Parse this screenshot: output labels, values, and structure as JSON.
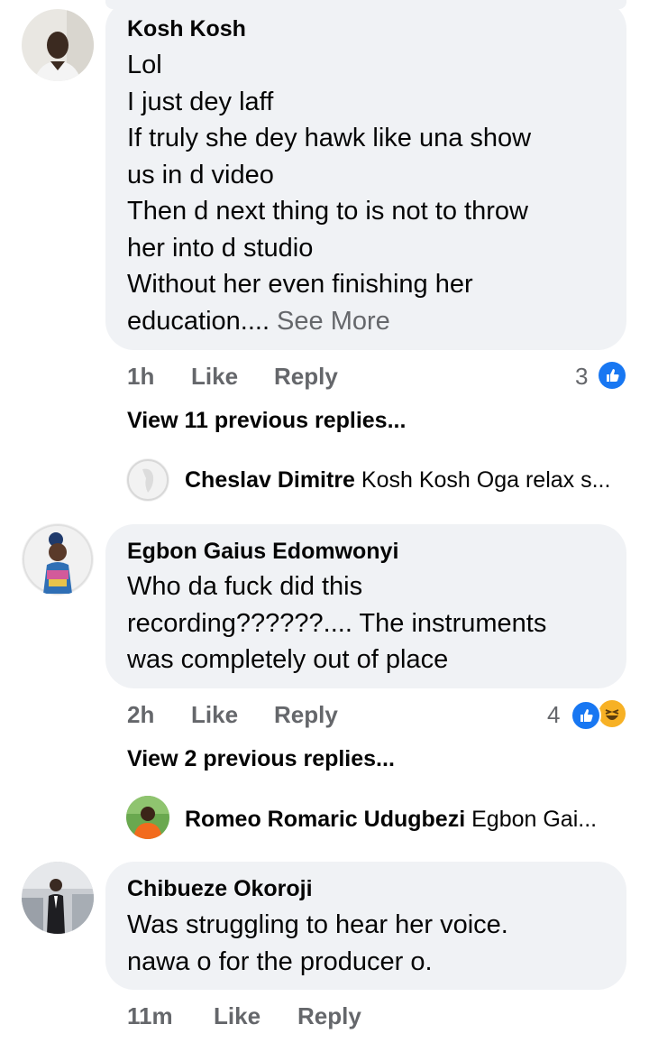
{
  "comments": [
    {
      "author": "Kosh Kosh",
      "lines": [
        "Lol",
        "I just dey laff",
        "If truly she dey hawk like una show",
        "us in d video",
        "Then d next thing to is not to throw",
        "her into d studio",
        "Without her even finishing her"
      ],
      "last_line": "education....",
      "see_more": " See More",
      "time": "1h",
      "like": "Like",
      "reply": "Reply",
      "reaction_count": "3",
      "view_previous": "View 11 previous replies...",
      "reply_preview": {
        "author": "Cheslav Dimitre",
        "text": "Kosh Kosh Oga relax s..."
      }
    },
    {
      "author": "Egbon Gaius Edomwonyi",
      "lines": [
        "Who da fuck did this",
        "recording??????.... The instruments",
        "was completely out of place"
      ],
      "time": "2h",
      "like": "Like",
      "reply": "Reply",
      "reaction_count": "4",
      "view_previous": "View 2 previous replies...",
      "reply_preview": {
        "author": "Romeo Romaric Udugbezi",
        "text": "Egbon Gai..."
      }
    },
    {
      "author": "Chibueze Okoroji",
      "lines": [
        "Was struggling to hear her voice.",
        "nawa o for the producer o."
      ],
      "time": "11m",
      "like": "Like",
      "reply": "Reply"
    }
  ],
  "colors": {
    "bubble": "#f0f2f5",
    "secondary_text": "#65676b",
    "like_blue": "#1877f2",
    "haha_yellow": "#f7b125"
  },
  "icons": {
    "like_reaction": "like-reaction-icon",
    "haha_reaction": "haha-reaction-icon"
  }
}
